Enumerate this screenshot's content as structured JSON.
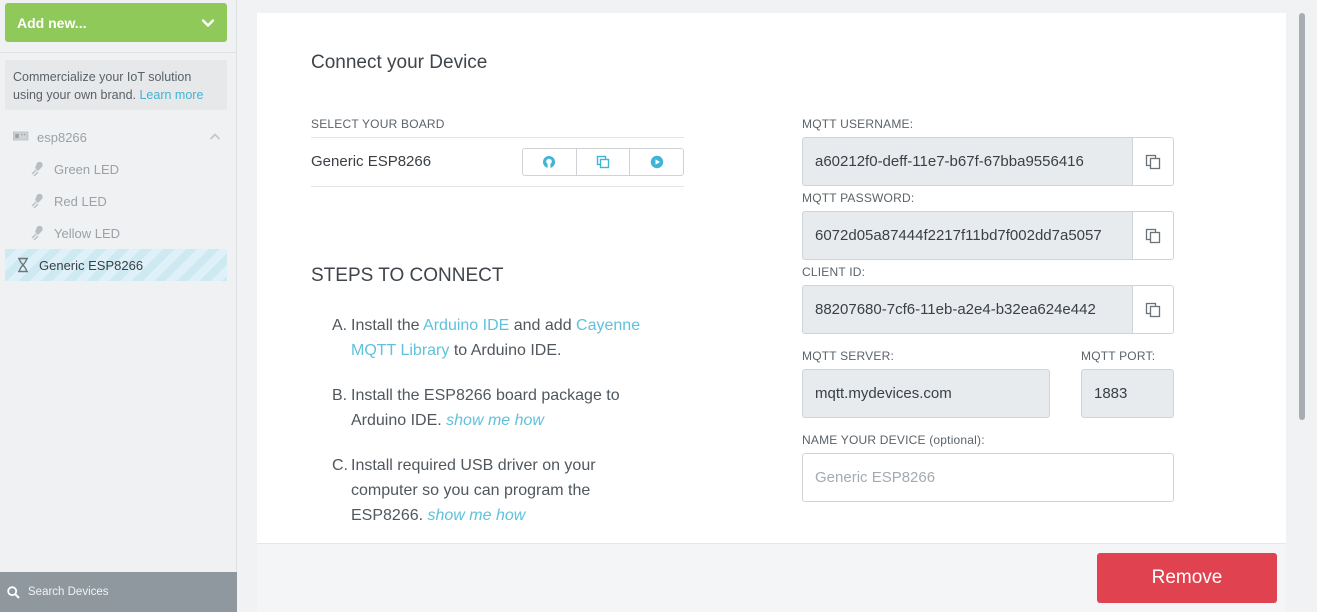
{
  "sidebar": {
    "add_new_label": "Add new...",
    "promo_text": "Commercialize your IoT solution using your own brand.",
    "promo_link": "Learn more",
    "device_group": "esp8266",
    "items": [
      {
        "label": "Green LED",
        "icon": "led-icon"
      },
      {
        "label": "Red LED",
        "icon": "led-icon"
      },
      {
        "label": "Yellow LED",
        "icon": "led-icon"
      }
    ],
    "selected_device": "Generic ESP8266",
    "search_label": "Search Devices"
  },
  "main": {
    "title": "Connect your Device",
    "select_board_label": "SELECT YOUR BOARD",
    "board_name": "Generic ESP8266",
    "board_buttons": [
      "github-icon",
      "copy-icon",
      "play-icon"
    ],
    "steps_title": "STEPS TO CONNECT",
    "steps": {
      "a_letter": "A.",
      "a_text1": "Install the ",
      "a_link1": "Arduino IDE",
      "a_text2": " and add ",
      "a_link2": "Cayenne MQTT Library",
      "a_text3": " to Arduino IDE.",
      "b_letter": "B.",
      "b_text": "Install the ESP8266 board package to Arduino IDE. ",
      "b_link": "show me how",
      "c_letter": "C.",
      "c_text": "Install required USB driver on your computer so you can program the ESP8266. ",
      "c_link": "show me how"
    },
    "mqtt_username_label": "MQTT USERNAME:",
    "mqtt_username": "a60212f0-deff-11e7-b67f-67bba9556416",
    "mqtt_password_label": "MQTT PASSWORD:",
    "mqtt_password": "6072d05a87444f2217f11bd7f002dd7a5057",
    "client_id_label": "CLIENT ID:",
    "client_id": "88207680-7cf6-11eb-a2e4-b32ea624e442",
    "mqtt_server_label": "MQTT SERVER:",
    "mqtt_server": "mqtt.mydevices.com",
    "mqtt_port_label": "MQTT PORT:",
    "mqtt_port": "1883",
    "name_device_label": "NAME YOUR DEVICE",
    "name_device_optional": "(optional):",
    "name_device_placeholder": "Generic ESP8266",
    "remove_label": "Remove"
  },
  "colors": {
    "accent_green": "#8fc95a",
    "link_blue": "#3fb4d6",
    "danger_red": "#e0434f"
  }
}
